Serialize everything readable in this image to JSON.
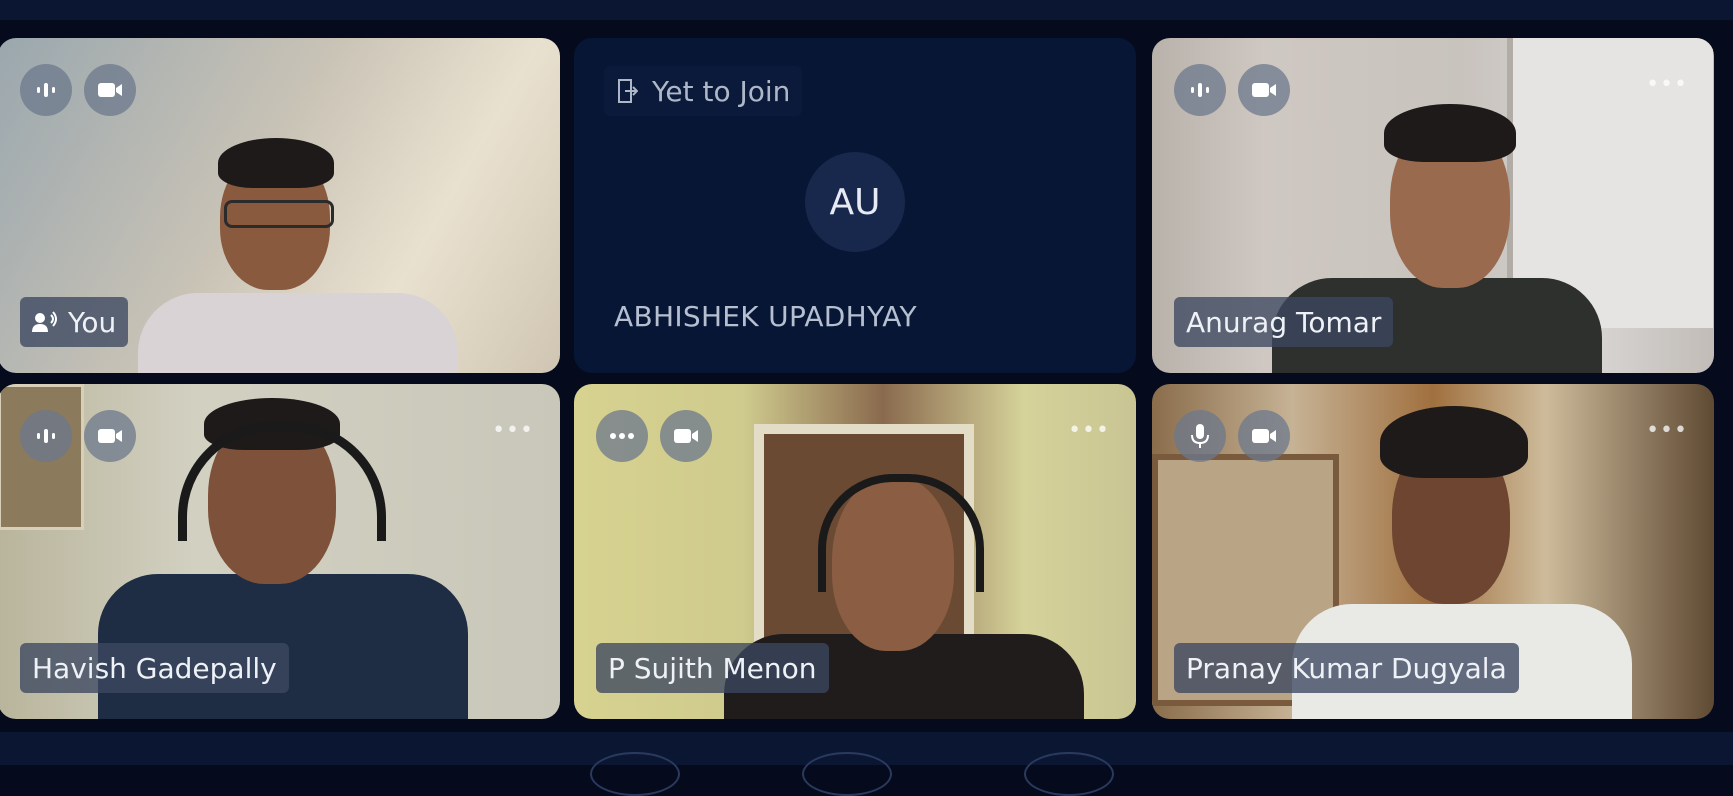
{
  "participants": [
    {
      "name": "You",
      "tag_icon": "speaker-icon",
      "mic_icon": "audio-active-icon",
      "cam_icon": "video-camera-icon",
      "show_more": false
    },
    {
      "name": "ABHISHEK UPADHYAY",
      "status": "Yet to Join",
      "status_icon": "exit-door-icon",
      "avatar_initials": "AU"
    },
    {
      "name": "Anurag Tomar",
      "mic_icon": "audio-active-icon",
      "cam_icon": "video-camera-icon",
      "show_more": true
    },
    {
      "name": "Havish Gadepally",
      "mic_icon": "audio-active-icon",
      "cam_icon": "video-camera-icon",
      "show_more": true
    },
    {
      "name": "P Sujith Menon",
      "mic_icon": "more-dots-icon",
      "cam_icon": "video-camera-icon",
      "show_more": true
    },
    {
      "name": "Pranay Kumar Dugyala",
      "mic_icon": "microphone-icon",
      "cam_icon": "video-camera-icon",
      "show_more": true
    }
  ],
  "icons": {
    "more": "•••"
  },
  "colors": {
    "background": "#050b1d",
    "bar": "#0b1732",
    "placeholder_tile": "#061634",
    "avatar": "#17284c"
  }
}
